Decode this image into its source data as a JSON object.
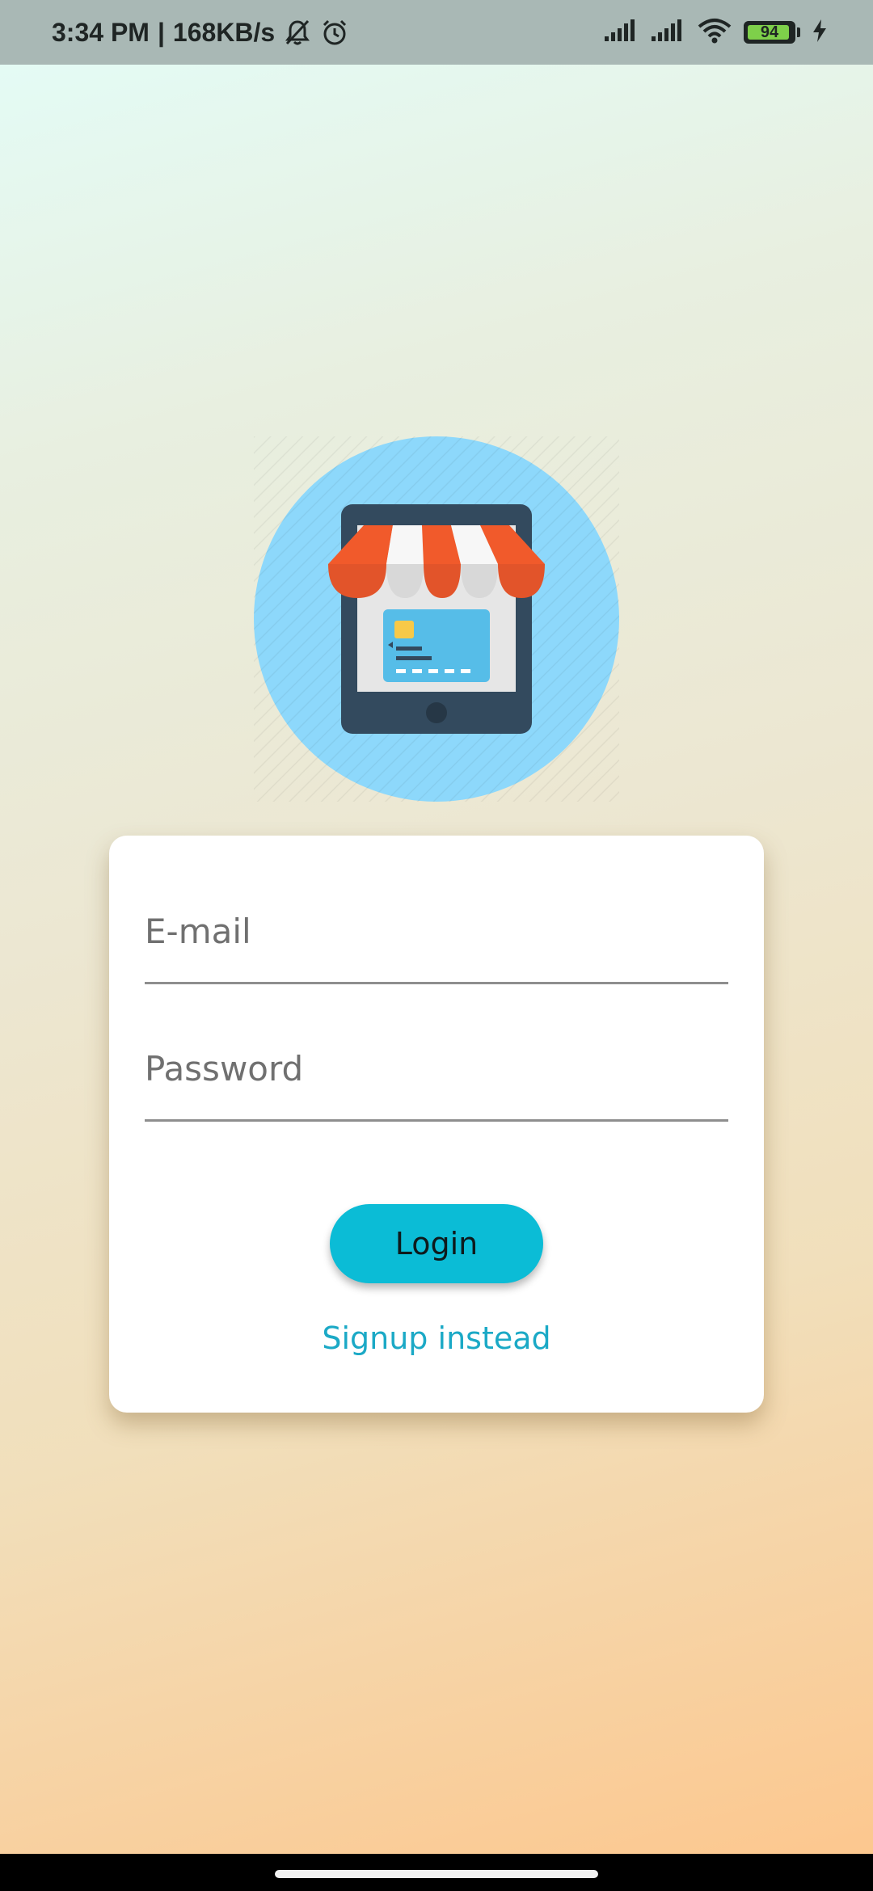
{
  "status_bar": {
    "time": "3:34 PM",
    "separator": "|",
    "speed": "168KB/s",
    "icons": [
      "bell-muted-icon",
      "alarm-icon",
      "signal-icon",
      "signal-icon",
      "wifi-icon",
      "battery-icon",
      "charging-icon"
    ],
    "battery_level": "94",
    "battery_fraction": 0.94
  },
  "logo": {
    "icon": "store-tablet-icon",
    "colors": {
      "circle": "#8dd8fb",
      "tablet": "#334a5e",
      "awning_orange": "#f15a2b",
      "card_blue": "#56bde8",
      "chip": "#f7c948"
    }
  },
  "login_form": {
    "email": {
      "placeholder": "E-mail",
      "value": ""
    },
    "password": {
      "placeholder": "Password",
      "value": ""
    },
    "login_label": "Login",
    "signup_label": "Signup instead"
  },
  "colors": {
    "accent": "#0bbcd6",
    "link": "#1ba9c6"
  }
}
